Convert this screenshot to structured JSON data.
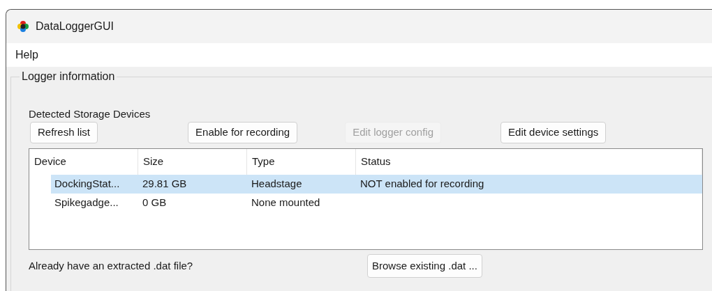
{
  "window": {
    "title": "DataLoggerGUI"
  },
  "menu": [
    "Help"
  ],
  "group": {
    "title": "Logger information",
    "label": "Detected Storage Devices"
  },
  "buttons": [
    {
      "label": "Refresh list",
      "disabled": false
    },
    {
      "label": "Enable for recording",
      "disabled": false
    },
    {
      "label": "Edit logger config",
      "disabled": true
    },
    {
      "label": "Edit device settings",
      "disabled": false
    }
  ],
  "table": {
    "columns": [
      "Device",
      "Size",
      "Type",
      "Status"
    ],
    "rows": [
      {
        "cells": [
          "DockingStat...",
          "29.81 GB",
          "Headstage",
          "NOT enabled for recording"
        ],
        "selected": true
      },
      {
        "cells": [
          "Spikegadge...",
          "0 GB",
          "None mounted",
          ""
        ],
        "selected": false
      }
    ]
  },
  "footer": {
    "text": "Already have an extracted .dat file?",
    "button": "Browse existing .dat ..."
  }
}
